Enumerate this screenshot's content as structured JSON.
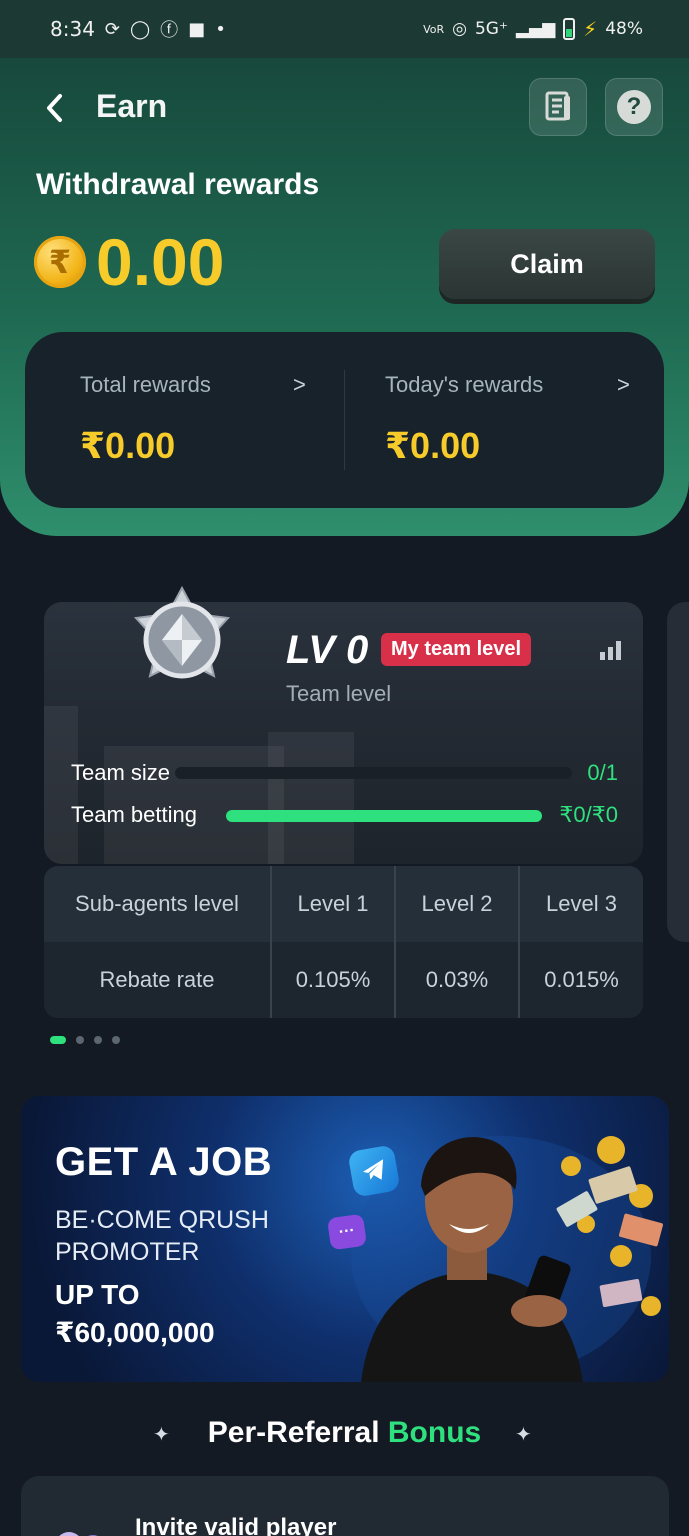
{
  "status_bar": {
    "time": "8:34",
    "network": "5G⁺",
    "battery": "48%"
  },
  "header": {
    "title": "Earn"
  },
  "withdrawal": {
    "title": "Withdrawal rewards",
    "currency_symbol": "₹",
    "amount": "0.00",
    "claim_label": "Claim"
  },
  "stats": {
    "total_label": "Total rewards",
    "total_value": "₹0.00",
    "today_label": "Today's rewards",
    "today_value": "₹0.00"
  },
  "team": {
    "level": "LV 0",
    "badge": "My team level",
    "subtitle": "Team level",
    "size_label": "Team size",
    "size_value": "0/1",
    "size_progress": 0,
    "betting_label": "Team betting",
    "betting_value": "₹0/₹0",
    "betting_progress": 1
  },
  "rebate_table": {
    "headers": [
      "Sub-agents level",
      "Level 1",
      "Level 2",
      "Level 3"
    ],
    "values": [
      "Rebate rate",
      "0.105%",
      "0.03%",
      "0.015%"
    ]
  },
  "carousel": {
    "page_count": 4,
    "active_index": 0
  },
  "banner": {
    "headline": "GET A JOB",
    "line2": "BE·COME QRUSH",
    "line3": "PROMOTER",
    "line4": "UP TO",
    "line5": "₹60,000,000"
  },
  "referral": {
    "title_main": "Per-Referral ",
    "title_accent": "Bonus",
    "invite_text": "Invite valid player"
  },
  "colors": {
    "accent_green": "#2ee07e",
    "gold": "#f7cc2a",
    "badge_red": "#d9304a"
  },
  "icons": [
    "back-arrow-icon",
    "receipt-icon",
    "help-icon",
    "rupee-coin-icon",
    "chevron-right-icon",
    "medal-icon",
    "bar-chart-icon",
    "telegram-icon",
    "chat-icon",
    "sparkle-icon"
  ]
}
